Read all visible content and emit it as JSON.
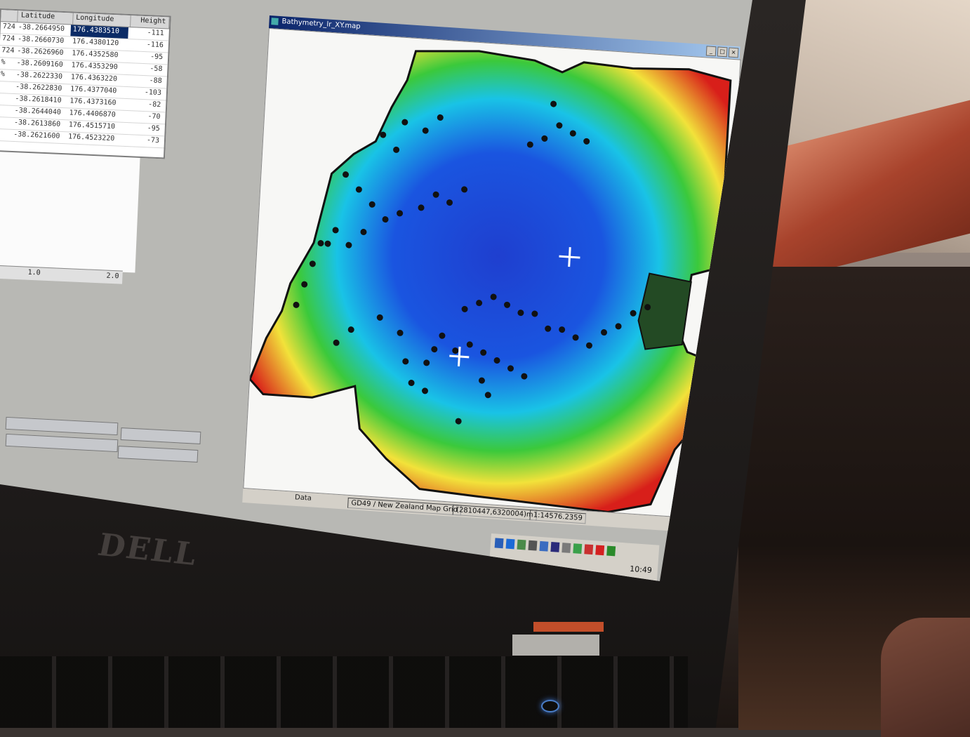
{
  "table": {
    "headers": [
      "Latitude",
      "Longitude",
      "Height"
    ],
    "rows": [
      {
        "id": "724",
        "lat": "-38.2664950",
        "lon": "176.4383510",
        "h": "-111"
      },
      {
        "id": "724",
        "lat": "-38.2660730",
        "lon": "176.4380120",
        "h": "-116"
      },
      {
        "id": "724",
        "lat": "-38.2626960",
        "lon": "176.4352580",
        "h": "-95"
      },
      {
        "id": "%",
        "lat": "-38.2609160",
        "lon": "176.4353290",
        "h": "-58"
      },
      {
        "id": "%",
        "lat": "-38.2622330",
        "lon": "176.4363220",
        "h": "-88"
      },
      {
        "id": "",
        "lat": "-38.2622830",
        "lon": "176.4377040",
        "h": "-103"
      },
      {
        "id": "",
        "lat": "-38.2618410",
        "lon": "176.4373160",
        "h": "-82"
      },
      {
        "id": "",
        "lat": "-38.2644040",
        "lon": "176.4406870",
        "h": "-70"
      },
      {
        "id": "",
        "lat": "-38.2613860",
        "lon": "176.4515710",
        "h": "-95"
      },
      {
        "id": "",
        "lat": "-38.2621600",
        "lon": "176.4523220",
        "h": "-73"
      }
    ],
    "ruler": [
      "1.0",
      "2.0"
    ]
  },
  "map_window": {
    "title": "Bathymetry_lr_XY.map",
    "status": {
      "projection": "GD49 / New Zealand Map Grid",
      "coords": "(2810447,6320004)m",
      "scale": "1:14576.2359"
    },
    "data_label": "Data"
  },
  "tray": {
    "clock": "10:49"
  },
  "colors": {
    "deep": "#1f3fcf",
    "mid": "#19c3e6",
    "shallow_green": "#3bc93b",
    "shallow_yellow": "#f2e23a",
    "shore": "#d81f1a"
  },
  "brand": "DELL"
}
